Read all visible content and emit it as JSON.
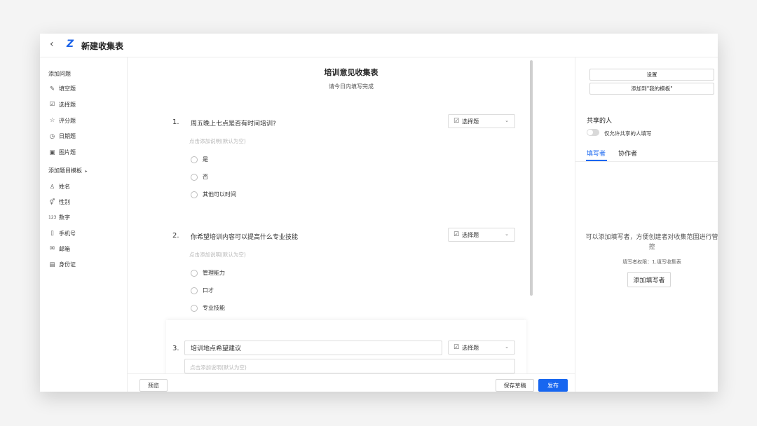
{
  "window": {
    "title": "新建收集表",
    "logo": "Z",
    "back": "‹"
  },
  "sidebar": {
    "add_question_head": "添加问题",
    "question_types": [
      {
        "label": "填空题",
        "icon": "edit-icon",
        "glyph": "✎"
      },
      {
        "label": "选择题",
        "icon": "checkbox-icon",
        "glyph": "☑"
      },
      {
        "label": "评分题",
        "icon": "star-icon",
        "glyph": "☆"
      },
      {
        "label": "日期题",
        "icon": "clock-icon",
        "glyph": "◷"
      },
      {
        "label": "图片题",
        "icon": "image-icon",
        "glyph": "▣"
      }
    ],
    "template_head": "添加题目模板",
    "template_arrow": "▸",
    "templates": [
      {
        "label": "姓名",
        "icon": "person-icon",
        "glyph": "♙"
      },
      {
        "label": "性别",
        "icon": "gender-icon",
        "glyph": "⚥"
      },
      {
        "label": "数字",
        "icon": "number-icon",
        "glyph": "123"
      },
      {
        "label": "手机号",
        "icon": "phone-icon",
        "glyph": "▯"
      },
      {
        "label": "邮箱",
        "icon": "mail-icon",
        "glyph": "✉"
      },
      {
        "label": "身份证",
        "icon": "id-card-icon",
        "glyph": "▤"
      }
    ]
  },
  "form": {
    "title": "培训意见收集表",
    "subtitle": "请今日内填写完成",
    "desc_placeholder": "点击添加说明(默认为空)",
    "type_label": "选择题",
    "questions": [
      {
        "num": "1.",
        "title": "周五晚上七点是否有时间培训?",
        "options": [
          "是",
          "否",
          "其他可以时间"
        ]
      },
      {
        "num": "2.",
        "title": "你希望培训内容可以提高什么专业技能",
        "options": [
          "管理能力",
          "口才",
          "专业技能"
        ]
      },
      {
        "num": "3.",
        "title": "培训地点希望建议"
      }
    ]
  },
  "footer": {
    "preview": "预览",
    "save_draft": "保存草稿",
    "publish": "发布"
  },
  "right_panel": {
    "settings": "设置",
    "add_template": "添加到\"我的模板\"",
    "share_title": "共享的人",
    "toggle_label": "仅允许共享的人填写",
    "tabs": [
      "填写者",
      "协作者"
    ],
    "empty_text": "可以添加填写者，方便创建者对收集范围进行管控",
    "permission_text": "填写者权限：1.填写收集表",
    "add_filler": "添加填写者"
  },
  "colors": {
    "accent": "#1766f0",
    "logo": "#1c63e8"
  }
}
